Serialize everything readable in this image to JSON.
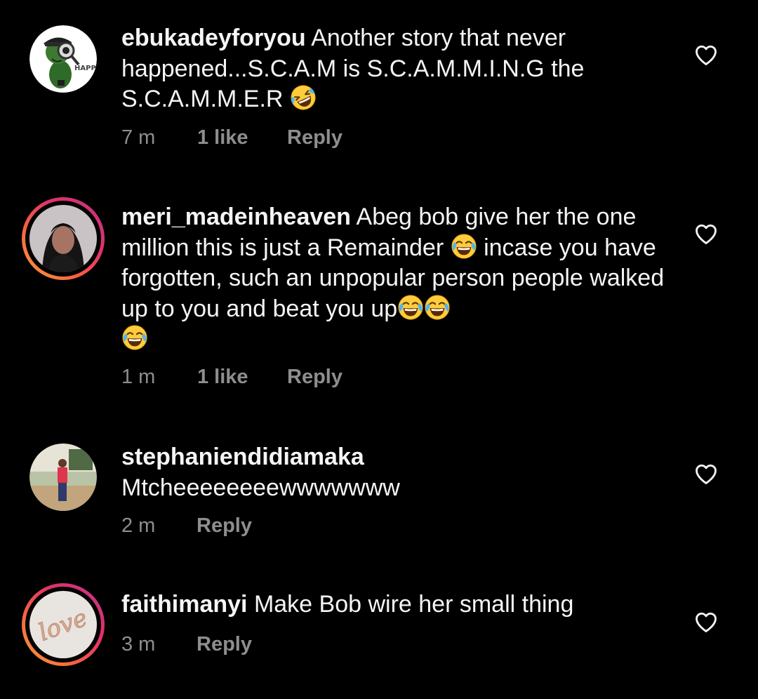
{
  "comments": [
    {
      "username": "ebukadeyforyou",
      "text": "Another story that never happened...S.C.A.M is S.C.A.M.M.I.N.G the S.C.A.M.M.E.R",
      "time": "7 m",
      "likes": "1 like",
      "reply": "Reply",
      "avatar_icon": "cartoon-detective-avatar",
      "avatar_text": "HAPP"
    },
    {
      "username": "meri_madeinheaven",
      "text_a": "Abeg bob give her the one million this is just a  Remainder",
      "text_b": "incase you have forgotten, such an unpopular person people walked up to you and beat you up",
      "time": "1 m",
      "likes": "1 like",
      "reply": "Reply",
      "avatar_icon": "profile-photo-avatar"
    },
    {
      "username": "stephaniendidiamaka",
      "text": "Mtcheeeeeeeewwwwwww",
      "time": "2 m",
      "reply": "Reply",
      "avatar_icon": "profile-photo-avatar"
    },
    {
      "username": "faithimanyi",
      "text": "Make Bob wire her small thing",
      "time": "3 m",
      "reply": "Reply",
      "avatar_icon": "love-balloon-avatar",
      "avatar_text": "love"
    }
  ],
  "colors": {
    "background": "#000000",
    "text": "#f5f5f5",
    "meta": "#8e8e8e",
    "story_ring": [
      "#f9a03a",
      "#f56040",
      "#e1306c",
      "#c13584"
    ]
  },
  "icons": {
    "like": "heart-outline-icon",
    "rofl": "rolling-on-floor-laughing-emoji",
    "joy": "tears-of-joy-emoji"
  }
}
